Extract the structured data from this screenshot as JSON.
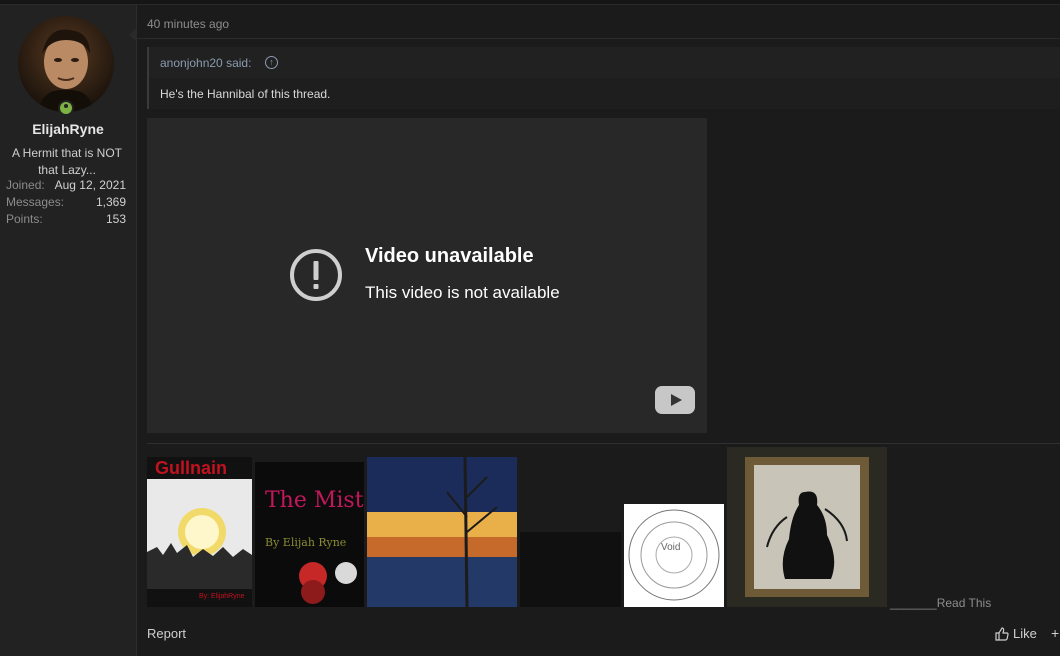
{
  "user": {
    "name": "ElijahRyne",
    "title": "A Hermit that is NOT that Lazy...",
    "stats": [
      {
        "label": "Joined:",
        "value": "Aug 12, 2021"
      },
      {
        "label": "Messages:",
        "value": "1,369"
      },
      {
        "label": "Points:",
        "value": "153"
      }
    ]
  },
  "post": {
    "time": "40 minutes ago",
    "quote": {
      "author": "anonjohn20 said:",
      "text": "He's the Hannibal of this thread."
    },
    "video": {
      "title": "Video unavailable",
      "subtitle": "This video is not available"
    }
  },
  "signature": {
    "images": [
      {
        "name": "gullnain-cover",
        "title": "Gullnain",
        "caption": "By: ElijahRyne"
      },
      {
        "name": "the-mist-of-love-cover",
        "title": "The Mist of LOVE",
        "caption": "By Elijah Ryne"
      },
      {
        "name": "night-street-painting"
      },
      {
        "name": "dark-image"
      },
      {
        "name": "void-circle",
        "title": "Void"
      },
      {
        "name": "framed-figure"
      }
    ],
    "read_this": "_______Read This"
  },
  "actions": {
    "report": "Report",
    "like": "Like",
    "more": "+"
  }
}
